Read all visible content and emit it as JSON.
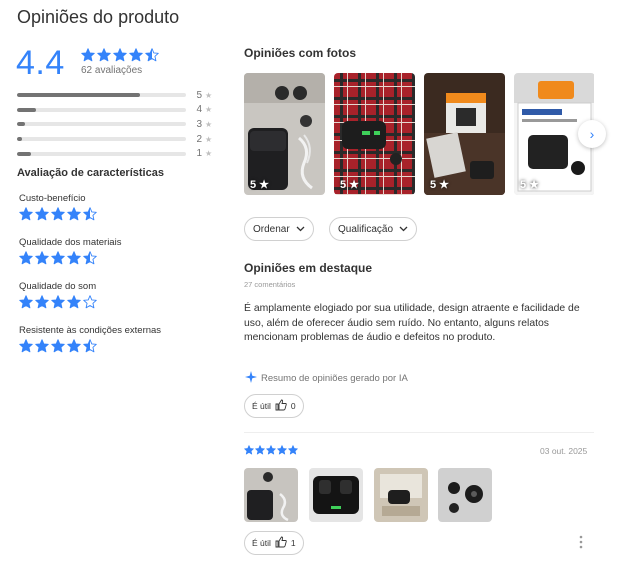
{
  "page": {
    "title": "Opiniões do produto"
  },
  "summary": {
    "average": "4.4",
    "count_label": "62 avaliações",
    "average_value": 4.4
  },
  "distribution": [
    {
      "stars": "5",
      "fraction": 0.73
    },
    {
      "stars": "4",
      "fraction": 0.11
    },
    {
      "stars": "3",
      "fraction": 0.05
    },
    {
      "stars": "2",
      "fraction": 0.03
    },
    {
      "stars": "1",
      "fraction": 0.08
    }
  ],
  "characteristics": {
    "title": "Avaliação de características",
    "items": [
      {
        "label": "Custo-benefício",
        "rating": 4.5
      },
      {
        "label": "Qualidade dos materiais",
        "rating": 4.5
      },
      {
        "label": "Qualidade do som",
        "rating": 4.0
      },
      {
        "label": "Resistente às condições externas",
        "rating": 4.5
      }
    ]
  },
  "photos_section": {
    "title": "Opiniões com fotos",
    "photos": [
      {
        "rating": "5",
        "icon": "photo-earbuds-case"
      },
      {
        "rating": "5",
        "icon": "photo-mic-on-plaid"
      },
      {
        "rating": "5",
        "icon": "photo-box-on-table"
      },
      {
        "rating": "5",
        "icon": "photo-product-box"
      }
    ]
  },
  "filters": {
    "order_label": "Ordenar",
    "rating_label": "Qualificação"
  },
  "featured": {
    "title": "Opiniões em destaque",
    "count_label": "27 comentários",
    "text": "É amplamente elogiado por sua utilidade, design atraente e facilidade de uso, além de oferecer áudio sem ruído. No entanto, alguns relatos mencionam problemas de áudio e defeitos no produto.",
    "ai_note": "Resumo de opiniões gerado por IA",
    "useful_label": "É útil",
    "useful_count": "0"
  },
  "review": {
    "rating": 5,
    "date": "03 out. 2025",
    "useful_label": "É útil",
    "useful_count": "1"
  },
  "colors": {
    "accent": "#3483fa",
    "muted": "#737373"
  }
}
